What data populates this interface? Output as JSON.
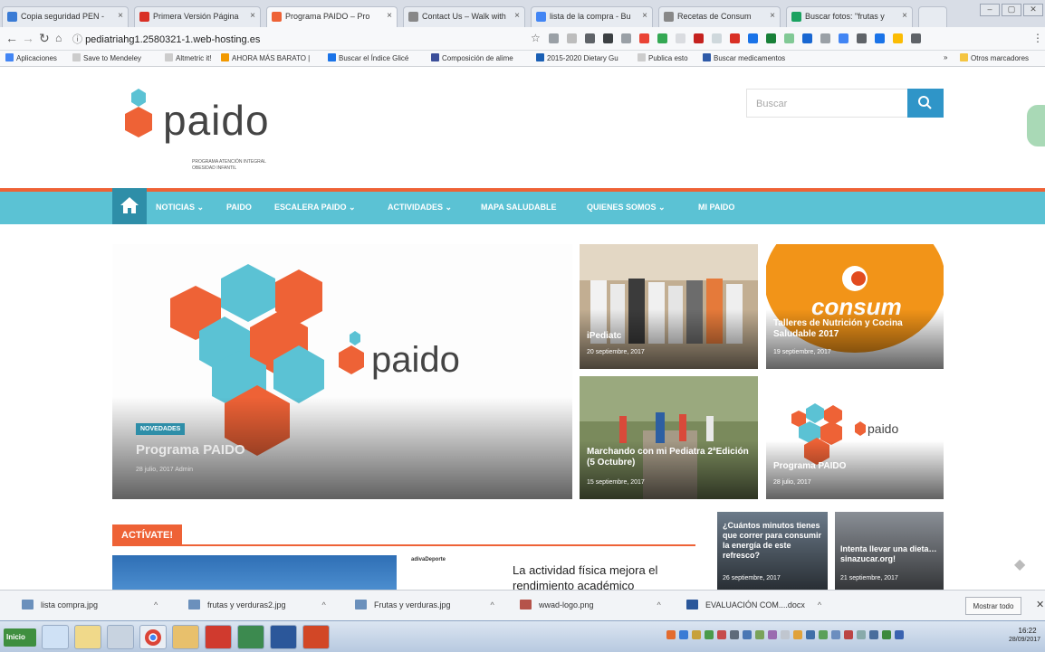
{
  "browser": {
    "tabs": [
      {
        "label": "Copia seguridad PEN - ",
        "color": "#3a7bd5"
      },
      {
        "label": "Primera Versión Página",
        "color": "#d93025"
      },
      {
        "label": "Programa PAIDO – Pro",
        "color": "#ee6236"
      },
      {
        "label": "Contact Us – Walk with",
        "color": "#888888"
      },
      {
        "label": "lista de la compra - Bu",
        "color": "#4285f4"
      },
      {
        "label": "Recetas de Consum",
        "color": "#888888"
      },
      {
        "label": "Buscar fotos: \"frutas y",
        "color": "#1aa260"
      }
    ],
    "url": "pediatriahg1.2580321-1.web-hosting.es",
    "bookmarks": [
      {
        "label": "Aplicaciones",
        "color": "#4285f4"
      },
      {
        "label": "Save to Mendeley",
        "color": "#bbbbbb"
      },
      {
        "label": "Altmetric it!",
        "color": "#bbbbbb"
      },
      {
        "label": "AHORA MÁS BARATO |",
        "color": "#f29900"
      },
      {
        "label": "Buscar el Índice Glicé",
        "color": "#1a73e8"
      },
      {
        "label": "Composición de alime",
        "color": "#3c4f9a"
      },
      {
        "label": "2015-2020 Dietary Gu",
        "color": "#1a5fb4"
      },
      {
        "label": "Publica esto",
        "color": "#bbbbbb"
      },
      {
        "label": "Buscar medicamentos",
        "color": "#2e5aa8"
      }
    ],
    "other_bookmarks": "Otros marcadores"
  },
  "site": {
    "logo_word": "paido",
    "logo_tagline": "PROGRAMA ATENCIÓN INTEGRAL OBESIDAD INFANTIL",
    "search_placeholder": "Buscar",
    "menu": [
      {
        "label": "NOTICIAS ⌄"
      },
      {
        "label": "PAIDO"
      },
      {
        "label": "ESCALERA PAIDO ⌄"
      },
      {
        "label": "ACTIVIDADES ⌄"
      },
      {
        "label": "MAPA SALUDABLE"
      },
      {
        "label": "QUIENES SOMOS ⌄"
      },
      {
        "label": "MI PAIDO"
      }
    ],
    "featured": {
      "category": "NOVEDADES",
      "title": "Programa PAIDO",
      "meta": "28 julio, 2017   Admin",
      "logo_word": "paido"
    },
    "tiles": [
      {
        "title": "iPediatc",
        "meta": "20 septiembre, 2017"
      },
      {
        "title": "Talleres de Nutrición y Cocina Saludable 2017",
        "meta": "19 septiembre, 2017",
        "brand": "consum"
      },
      {
        "title": "Marchando con mi Pediatra 2ªEdición (5 Octubre)",
        "meta": "15 septiembre, 2017"
      },
      {
        "title": "Programa PAIDO",
        "meta": "28 julio, 2017",
        "logo_word": "paido"
      }
    ],
    "section_title": "ACTÍVATE!",
    "article_link": "La actividad física mejora el rendimiento académico",
    "article_thumb_label": "adivaDeporte",
    "small_tiles": [
      {
        "title": "¿Cuántos minutos tienes que correr para consumir la energía de este refresco?",
        "meta": "26 septiembre, 2017"
      },
      {
        "title": "Intenta llevar una dieta…sinazucar.org!",
        "meta": "21 septiembre, 2017"
      }
    ]
  },
  "downloads": {
    "items": [
      {
        "label": "lista compra.jpg"
      },
      {
        "label": "frutas y verduras2.jpg"
      },
      {
        "label": "Frutas y verduras.jpg"
      },
      {
        "label": "wwad-logo.png"
      },
      {
        "label": "EVALUACIÓN COM....docx"
      }
    ],
    "show_all": "Mostrar todo"
  },
  "taskbar": {
    "start": "Inicio",
    "time": "16:22",
    "date": "28/09/2017"
  }
}
